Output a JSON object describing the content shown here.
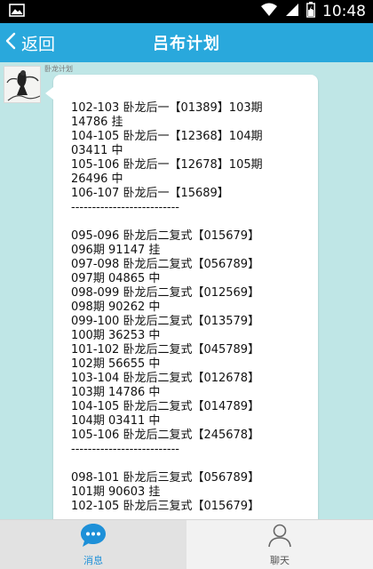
{
  "status_bar": {
    "time": "10:48",
    "icons": [
      "image-icon",
      "wifi-icon",
      "signal-icon",
      "battery-icon"
    ]
  },
  "header": {
    "back_label": "返回",
    "title": "吕布计划"
  },
  "message": {
    "sender": "卧龙计划",
    "lines": [
      "102-103 卧龙后一【01389】103期",
      "14786 挂",
      "104-105 卧龙后一【12368】104期",
      "03411 中",
      "105-106 卧龙后一【12678】105期",
      "26496 中",
      "106-107 卧龙后一【15689】",
      "--------------------------",
      "",
      "095-096 卧龙后二复式【015679】",
      "096期 91147 挂",
      "097-098 卧龙后二复式【056789】",
      "097期 04865 中",
      "098-099 卧龙后二复式【012569】",
      "098期 90262 中",
      "099-100 卧龙后二复式【013579】",
      "100期 36253 中",
      "101-102 卧龙后二复式【045789】",
      "102期 56655 中",
      "103-104 卧龙后二复式【012678】",
      "103期 14786 中",
      "104-105 卧龙后二复式【014789】",
      "104期 03411 中",
      "105-106 卧龙后二复式【245678】",
      "--------------------------",
      "",
      "098-101 卧龙后三复式【056789】",
      "101期 90603 挂",
      "102-105 卧龙后三复式【015679】"
    ]
  },
  "bottom_nav": {
    "tabs": [
      {
        "label": "消息",
        "icon": "chat-bubble-icon",
        "active": true
      },
      {
        "label": "聊天",
        "icon": "person-icon",
        "active": false
      }
    ]
  },
  "colors": {
    "title_bar": "#29a8dc",
    "background": "#bfe6e6",
    "active_tab_text": "#1e90d8"
  }
}
